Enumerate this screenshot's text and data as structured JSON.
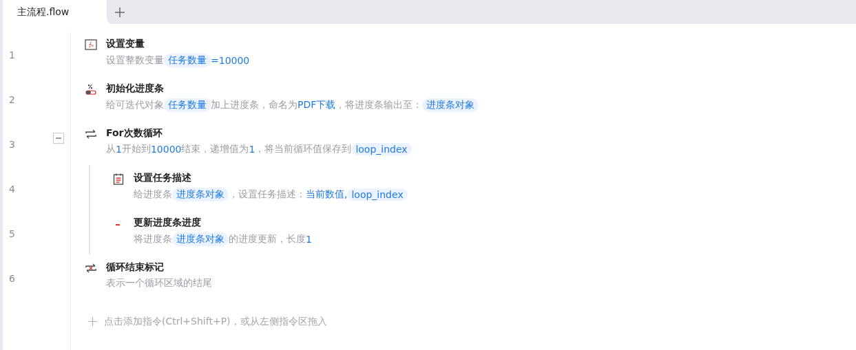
{
  "tabs": [
    {
      "label": "主流程.flow",
      "selected": true
    }
  ],
  "steps": [
    {
      "number": "1",
      "kind": "variable",
      "title": "设置变量",
      "description": [
        {
          "kind": "text",
          "text": "设置整数变量"
        },
        {
          "kind": "chip",
          "text": "任务数量"
        },
        {
          "kind": "value",
          "text": "=10000"
        }
      ]
    },
    {
      "number": "2",
      "kind": "progress",
      "title": "初始化进度条",
      "description": [
        {
          "kind": "text",
          "text": "给可迭代对象"
        },
        {
          "kind": "chip",
          "text": "任务数量"
        },
        {
          "kind": "text",
          "text": "加上进度条，命名为"
        },
        {
          "kind": "value",
          "text": "PDF下载"
        },
        {
          "kind": "text",
          "text": "，将进度条输出至："
        },
        {
          "kind": "chip",
          "text": "进度条对象"
        }
      ]
    },
    {
      "number": "3",
      "kind": "loop",
      "title": "For次数循环",
      "expanded": true,
      "description": [
        {
          "kind": "text",
          "text": "从"
        },
        {
          "kind": "value",
          "text": "1"
        },
        {
          "kind": "text",
          "text": "开始到"
        },
        {
          "kind": "value",
          "text": "10000"
        },
        {
          "kind": "text",
          "text": "结束，递增值为"
        },
        {
          "kind": "value",
          "text": "1"
        },
        {
          "kind": "text",
          "text": "，将当前循环值保存到"
        },
        {
          "kind": "chip",
          "text": "loop_index"
        }
      ],
      "children": [
        {
          "number": "4",
          "kind": "note",
          "title": "设置任务描述",
          "description": [
            {
              "kind": "text",
              "text": "给进度条"
            },
            {
              "kind": "chip",
              "text": "进度条对象"
            },
            {
              "kind": "text",
              "text": "，设置任务描述："
            },
            {
              "kind": "value",
              "text": "当前数值,"
            },
            {
              "kind": "chip",
              "text": "loop_index"
            }
          ]
        },
        {
          "number": "5",
          "kind": "update",
          "title": "更新进度条进度",
          "description": [
            {
              "kind": "text",
              "text": "将进度条"
            },
            {
              "kind": "chip",
              "text": "进度条对象"
            },
            {
              "kind": "text",
              "text": "的进度更新，长度"
            },
            {
              "kind": "value",
              "text": "1"
            }
          ]
        }
      ]
    },
    {
      "number": "6",
      "kind": "loop-end",
      "title": "循环结束标记",
      "description": [
        {
          "kind": "text",
          "text": "表示一个循环区域的结尾"
        }
      ]
    }
  ],
  "add_hint": "点击添加指令(Ctrl+Shift+P)，或从左侧指令区拖入"
}
